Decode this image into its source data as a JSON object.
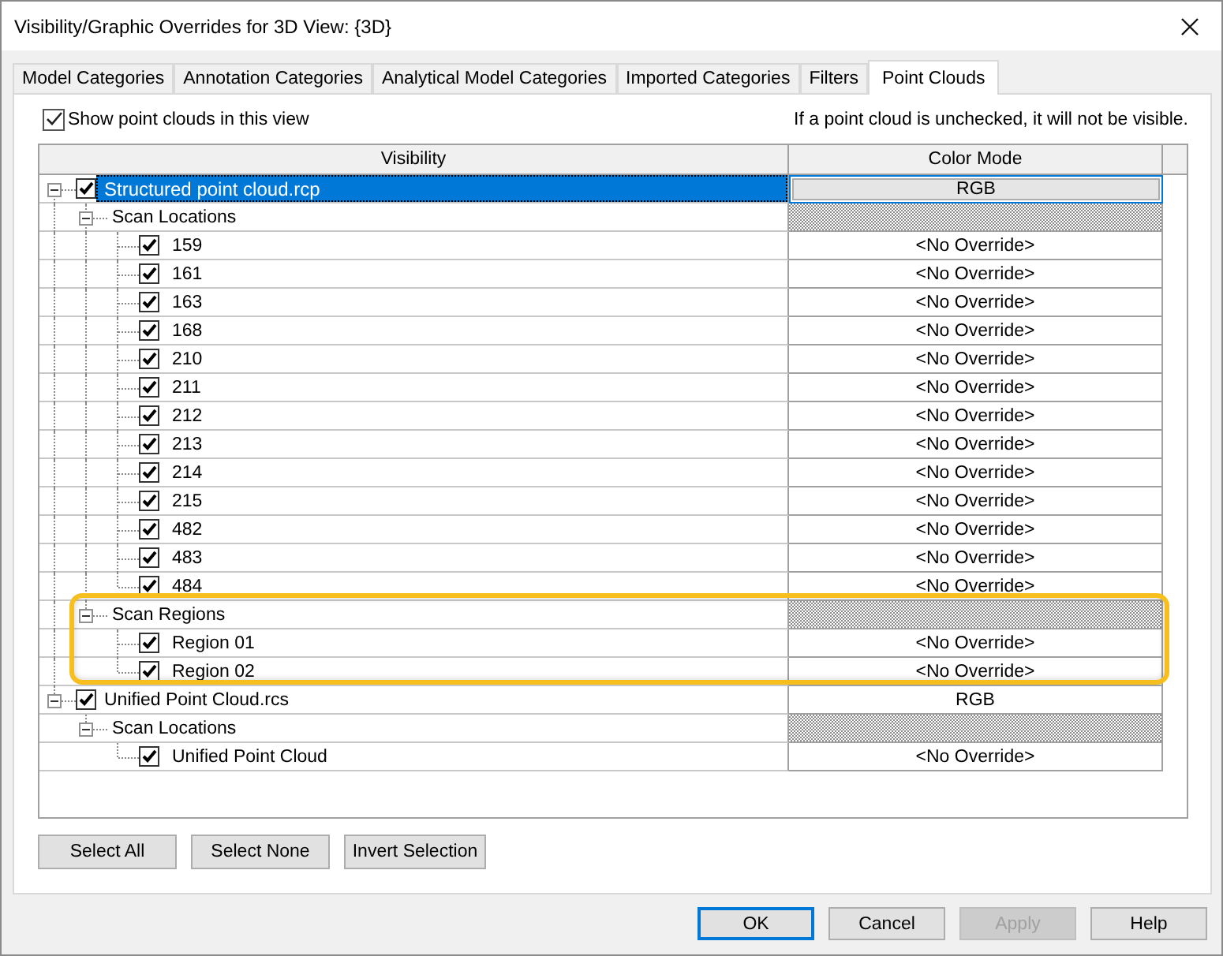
{
  "window": {
    "title": "Visibility/Graphic Overrides for 3D View: {3D}"
  },
  "tabs": [
    {
      "label": "Model Categories",
      "selected": false
    },
    {
      "label": "Annotation Categories",
      "selected": false
    },
    {
      "label": "Analytical Model Categories",
      "selected": false
    },
    {
      "label": "Imported Categories",
      "selected": false
    },
    {
      "label": "Filters",
      "selected": false
    },
    {
      "label": "Point Clouds",
      "selected": true
    }
  ],
  "show_point_clouds": {
    "label": "Show point clouds in this view",
    "checked": true
  },
  "note": "If a point cloud is unchecked, it will not be visible.",
  "table": {
    "columns": [
      "Visibility",
      "Color Mode"
    ],
    "rows": [
      {
        "kind": "cloud",
        "label": "Structured point cloud.rcp",
        "checked": true,
        "expanded": true,
        "selected": true,
        "color_mode": "RGB",
        "children": [
          {
            "kind": "group",
            "label": "Scan Locations",
            "expanded": true,
            "selected": false,
            "children": [
              {
                "kind": "scan",
                "label": "159",
                "checked": true,
                "selected": false,
                "color_mode": "<No Override>"
              },
              {
                "kind": "scan",
                "label": "161",
                "checked": true,
                "selected": false,
                "color_mode": "<No Override>"
              },
              {
                "kind": "scan",
                "label": "163",
                "checked": true,
                "selected": false,
                "color_mode": "<No Override>"
              },
              {
                "kind": "scan",
                "label": "168",
                "checked": true,
                "selected": false,
                "color_mode": "<No Override>"
              },
              {
                "kind": "scan",
                "label": "210",
                "checked": true,
                "selected": false,
                "color_mode": "<No Override>"
              },
              {
                "kind": "scan",
                "label": "211",
                "checked": true,
                "selected": false,
                "color_mode": "<No Override>"
              },
              {
                "kind": "scan",
                "label": "212",
                "checked": true,
                "selected": false,
                "color_mode": "<No Override>"
              },
              {
                "kind": "scan",
                "label": "213",
                "checked": true,
                "selected": false,
                "color_mode": "<No Override>"
              },
              {
                "kind": "scan",
                "label": "214",
                "checked": true,
                "selected": false,
                "color_mode": "<No Override>"
              },
              {
                "kind": "scan",
                "label": "215",
                "checked": true,
                "selected": false,
                "color_mode": "<No Override>"
              },
              {
                "kind": "scan",
                "label": "482",
                "checked": true,
                "selected": false,
                "color_mode": "<No Override>"
              },
              {
                "kind": "scan",
                "label": "483",
                "checked": true,
                "selected": false,
                "color_mode": "<No Override>"
              },
              {
                "kind": "scan",
                "label": "484",
                "checked": true,
                "selected": false,
                "color_mode": "<No Override>"
              }
            ]
          },
          {
            "kind": "group",
            "label": "Scan Regions",
            "expanded": true,
            "selected": false,
            "children": [
              {
                "kind": "scan",
                "label": "Region 01",
                "checked": true,
                "selected": false,
                "color_mode": "<No Override>"
              },
              {
                "kind": "scan",
                "label": "Region 02",
                "checked": true,
                "selected": false,
                "color_mode": "<No Override>"
              }
            ]
          }
        ]
      },
      {
        "kind": "cloud",
        "label": "Unified Point Cloud.rcs",
        "checked": true,
        "expanded": true,
        "selected": false,
        "color_mode": "RGB",
        "children": [
          {
            "kind": "group",
            "label": "Scan Locations",
            "expanded": true,
            "selected": false,
            "children": [
              {
                "kind": "scan",
                "label": "Unified Point Cloud",
                "checked": true,
                "selected": false,
                "color_mode": "<No Override>"
              }
            ]
          }
        ]
      }
    ]
  },
  "selection_buttons": [
    "Select All",
    "Select None",
    "Invert Selection"
  ],
  "dialog_buttons": [
    {
      "label": "OK",
      "default": true,
      "disabled": false
    },
    {
      "label": "Cancel",
      "default": false,
      "disabled": false
    },
    {
      "label": "Apply",
      "default": false,
      "disabled": true
    },
    {
      "label": "Help",
      "default": false,
      "disabled": false
    }
  ]
}
